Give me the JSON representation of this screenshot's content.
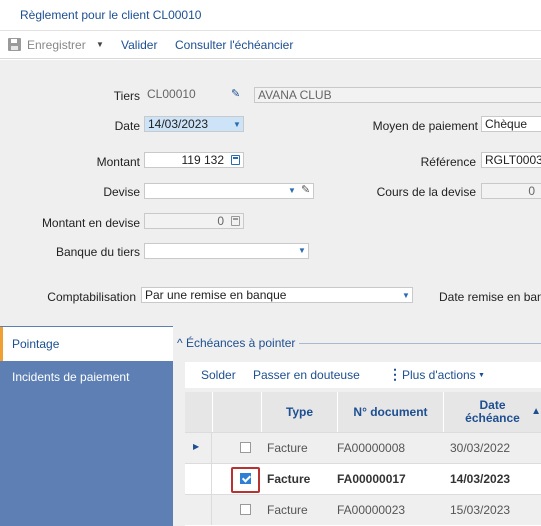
{
  "window": {
    "title": "Règlement pour le client CL00010"
  },
  "toolbar": {
    "save_label": "Enregistrer",
    "validate_label": "Valider",
    "schedule_label": "Consulter l'échéancier"
  },
  "form": {
    "tiers": {
      "label": "Tiers",
      "code": "CL00010",
      "name": "AVANA CLUB"
    },
    "date": {
      "label": "Date",
      "value": "14/03/2023"
    },
    "moyen": {
      "label": "Moyen de paiement",
      "value": "Chèque"
    },
    "montant": {
      "label": "Montant",
      "value": "119 132"
    },
    "reference": {
      "label": "Référence",
      "value": "RGLT0003"
    },
    "devise": {
      "label": "Devise",
      "value": ""
    },
    "cours": {
      "label": "Cours de la devise",
      "value": "0"
    },
    "montant_devise": {
      "label": "Montant en devise",
      "value": "0"
    },
    "banque": {
      "label": "Banque du tiers",
      "value": ""
    },
    "comptabilisation": {
      "label": "Comptabilisation",
      "value": "Par une remise en banque"
    },
    "date_remise": {
      "label": "Date remise en ban"
    }
  },
  "sidebar": {
    "items": [
      {
        "label": "Pointage",
        "active": true
      },
      {
        "label": "Incidents de paiement",
        "active": false
      }
    ]
  },
  "section": {
    "title": "Échéances à pointer",
    "actions": {
      "solder": "Solder",
      "douteuse": "Passer en douteuse",
      "more": "Plus d'actions"
    }
  },
  "grid": {
    "columns": {
      "type": "Type",
      "doc": "N° document",
      "date_line1": "Date",
      "date_line2": "échéance"
    },
    "rows": [
      {
        "type": "Facture",
        "doc": "FA00000008",
        "date": "30/03/2022",
        "checked": false
      },
      {
        "type": "Facture",
        "doc": "FA00000017",
        "date": "14/03/2023",
        "checked": true
      },
      {
        "type": "Facture",
        "doc": "FA00000023",
        "date": "15/03/2023",
        "checked": false
      }
    ]
  }
}
